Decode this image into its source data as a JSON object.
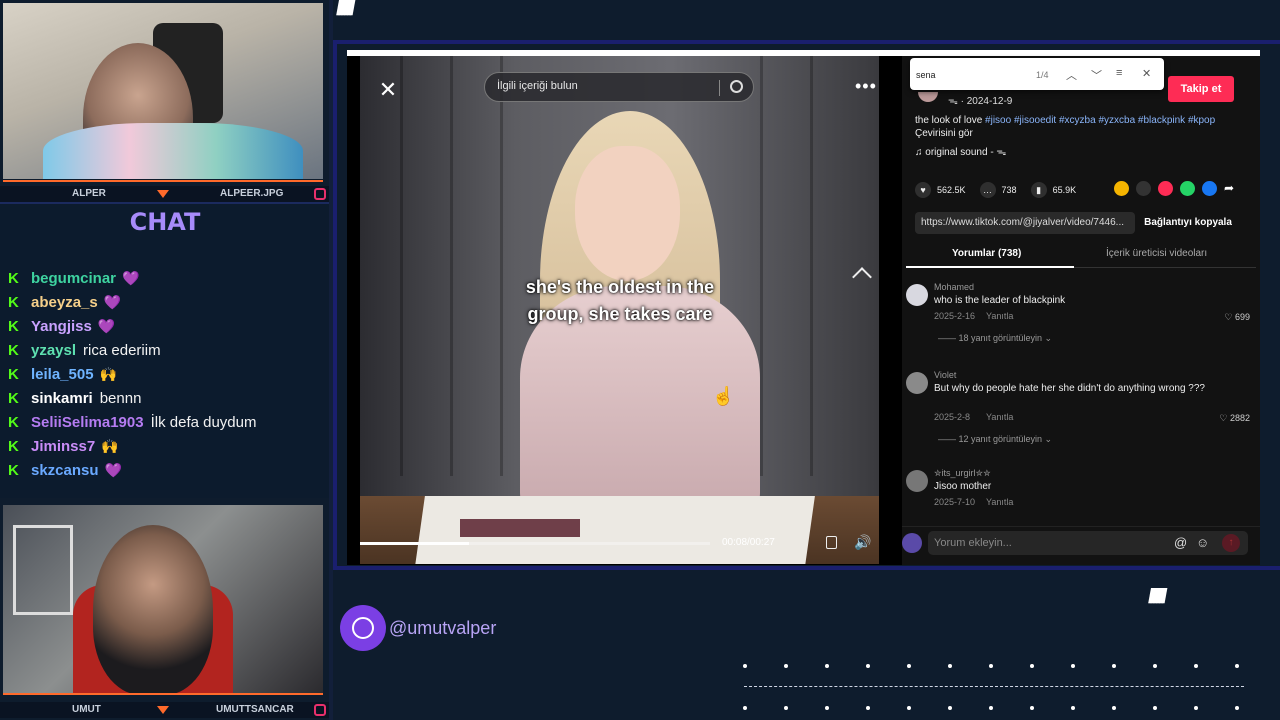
{
  "left": {
    "cam_top": {
      "name_left": "ALPER",
      "name_right": "ALPEER.JPG"
    },
    "chat": {
      "title": "CHAT",
      "messages": [
        {
          "user": "begumcinar",
          "user_color": "#3ed3a0",
          "msg": "",
          "emote": "💜"
        },
        {
          "user": "abeyza_s",
          "user_color": "#f6d08a",
          "msg": "",
          "emote": "💜"
        },
        {
          "user": "Yangjiss",
          "user_color": "#c9a2ff",
          "msg": "",
          "emote": "💜"
        },
        {
          "user": "yzaysl",
          "user_color": "#5ee0b0",
          "msg": "rica ederiim",
          "emote": ""
        },
        {
          "user": "leila_505",
          "user_color": "#6fb4ff",
          "msg": "",
          "emote": "🙌"
        },
        {
          "user": "sinkamri",
          "user_color": "#ffffff",
          "msg": "bennn",
          "emote": ""
        },
        {
          "user": "SeliiSelima1903",
          "user_color": "#b57cf2",
          "msg": "İlk defa duydum",
          "emote": ""
        },
        {
          "user": "Jiminss7",
          "user_color": "#c98cf7",
          "msg": "",
          "emote": "🙌"
        },
        {
          "user": "skzcansu",
          "user_color": "#6aa9ff",
          "msg": "",
          "emote": "💜"
        }
      ]
    },
    "cam_bottom": {
      "name_left": "UMUT",
      "name_right": "UMUTTSANCAR"
    }
  },
  "video": {
    "search_placeholder": "İlgili içeriği bulun",
    "subtitle_line1": "she's the oldest in the",
    "subtitle_line2": "group, she takes care",
    "time": "00:08/00:27",
    "progress": 0.31
  },
  "side": {
    "find": {
      "query": "sena",
      "count": "1/4"
    },
    "follow_label": "Takip et",
    "meta": "ᯓ · 2024-12-9",
    "caption_text": "the look of love",
    "caption_tags": "#jisoo #jisooedit #xcyzba #yzxcba #blackpink #kpop",
    "translate": "Çevirisini gör",
    "sound": "♫  original sound - ᯓ",
    "likes": "562.5K",
    "comments_count": "738",
    "saves": "65.9K",
    "url": "https://www.tiktok.com/@jiyalver/video/7446...",
    "copy_label": "Bağlantıyı kopyala",
    "tab_comments": "Yorumlar (738)",
    "tab_creator": "İçerik üreticisi videoları",
    "comment_list": [
      {
        "user": "Mohamed",
        "text": "who is the leader of blackpink",
        "date": "2025-2-16",
        "reply": "Yanıtla",
        "likes": "♡ 699",
        "more": "—— 18 yanıt görüntüleyin ⌄"
      },
      {
        "user": "Violet",
        "text": "But why do people hate her she didn't do anything wrong ???",
        "date": "2025-2-8",
        "reply": "Yanıtla",
        "likes": "♡ 2882",
        "more": "—— 12 yanıt görüntüleyin ⌄"
      },
      {
        "user": "✮its_urgirl✮✮",
        "text": "Jisoo mother",
        "date": "2025-7-10",
        "reply": "Yanıtla",
        "likes": "",
        "more": ""
      }
    ],
    "comment_placeholder": "Yorum ekleyin..."
  },
  "handle": "@umutvalper",
  "colors": {
    "accent": "#a78bfa",
    "follow": "#fe2c55",
    "kick_green": "#53fc18",
    "frame": "#1a1f6e"
  }
}
